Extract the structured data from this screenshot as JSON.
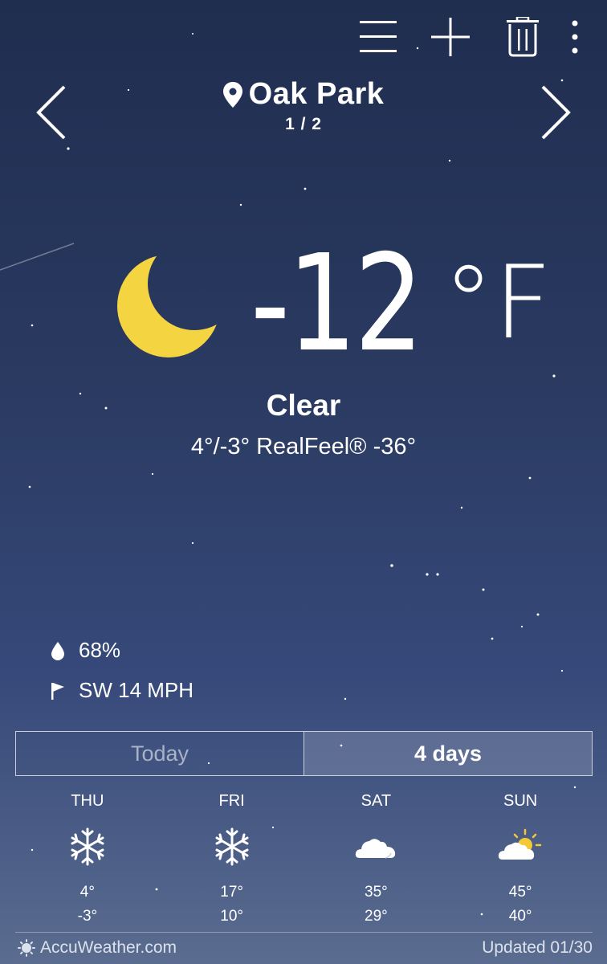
{
  "toolbar": {
    "menu_icon": "menu-icon",
    "add_icon": "plus-icon",
    "delete_icon": "trash-icon",
    "more_icon": "more-vertical-icon"
  },
  "location": {
    "name": "Oak Park",
    "page": "1 / 2",
    "icon": "location-pin-icon"
  },
  "current": {
    "icon": "moon-icon",
    "temperature": "-12",
    "unit": "°F",
    "condition": "Clear",
    "range_realfeel": "4°/-3° RealFeel® -36°"
  },
  "details": {
    "humidity": "68%",
    "humidity_icon": "droplet-icon",
    "wind": "SW 14 MPH",
    "wind_icon": "flag-icon"
  },
  "tabs": [
    {
      "label": "Today",
      "active": false
    },
    {
      "label": "4 days",
      "active": true
    }
  ],
  "forecast": [
    {
      "day": "THU",
      "icon": "snowflake-icon",
      "high": "4°",
      "low": "-3°"
    },
    {
      "day": "FRI",
      "icon": "snowflake-icon",
      "high": "17°",
      "low": "10°"
    },
    {
      "day": "SAT",
      "icon": "cloud-icon",
      "high": "35°",
      "low": "29°"
    },
    {
      "day": "SUN",
      "icon": "partly-sunny-icon",
      "high": "45°",
      "low": "40°"
    }
  ],
  "footer": {
    "brand": "AccuWeather.com",
    "brand_icon": "accuweather-sun-icon",
    "updated": "Updated 01/30"
  },
  "colors": {
    "moon": "#f5d442",
    "sun": "#f5c836",
    "background_top": "#1f2d4f",
    "background_bottom": "#5a6c8f"
  }
}
